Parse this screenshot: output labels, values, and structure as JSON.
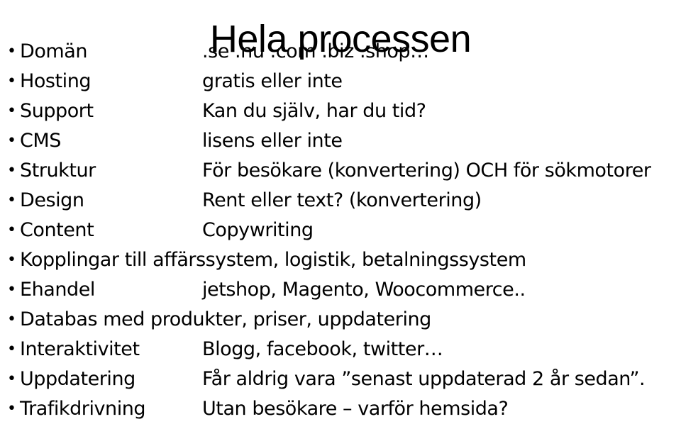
{
  "slide": {
    "title": "Hela processen",
    "background_color": "#ffffff",
    "text_color": "#000000",
    "bullet_glyph": "•",
    "rows": [
      {
        "term": "Domän",
        "desc": ".se .nu .com  .biz .shop…",
        "full": false
      },
      {
        "term": "Hosting",
        "desc": "gratis eller inte",
        "full": false
      },
      {
        "term": "Support",
        "desc": "Kan du själv, har du tid?",
        "full": false
      },
      {
        "term": "CMS",
        "desc": "lisens eller inte",
        "full": false
      },
      {
        "term": "Struktur",
        "desc": "För besökare (konvertering) OCH för sökmotorer",
        "full": false
      },
      {
        "term": "Design",
        "desc": "Rent eller text? (konvertering)",
        "full": false
      },
      {
        "term": "Content",
        "desc": "Copywriting",
        "full": false
      },
      {
        "term": "Kopplingar till affärssystem, logistik, betalningssystem",
        "desc": "",
        "full": true
      },
      {
        "term": "Ehandel",
        "desc": "jetshop, Magento, Woocommerce..",
        "full": false
      },
      {
        "term": "Databas med produkter, priser, uppdatering",
        "desc": "",
        "full": true
      },
      {
        "term": "Interaktivitet",
        "desc": "Blogg, facebook, twitter…",
        "full": false
      },
      {
        "term": "Uppdatering",
        "desc": "Får aldrig vara ”senast uppdaterad 2 år sedan”.",
        "full": false
      },
      {
        "term": "Trafikdrivning",
        "desc": "Utan besökare – varför hemsida?",
        "full": false
      }
    ]
  }
}
